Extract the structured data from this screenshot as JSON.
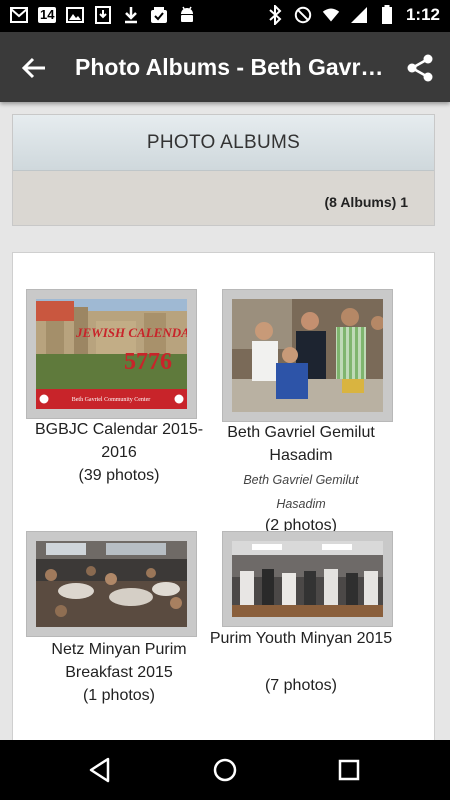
{
  "status_bar": {
    "notification_badge": "14",
    "time": "1:12",
    "left_icons": [
      "gmail-icon",
      "badge-icon",
      "image-icon",
      "download-box-icon",
      "download-icon",
      "checklist-icon",
      "android-icon"
    ],
    "right_icons": [
      "bluetooth-icon",
      "do-not-disturb-icon",
      "wifi-icon",
      "signal-icon",
      "battery-icon"
    ]
  },
  "app_bar": {
    "title": "Photo Albums - Beth Gavriel Bukharian Jewish Congregation",
    "back_icon": "arrow-left-icon",
    "share_icon": "share-icon"
  },
  "header": {
    "title": "PHOTO ALBUMS",
    "count": "(8 Albums) 1"
  },
  "albums": [
    {
      "title": "BGBJC Calendar 2015-2016",
      "subtitle": "",
      "count": "(39 photos)",
      "thumb_text_1": "JEWISH CALENDAR",
      "thumb_text_2": "5776",
      "thumb_text_3": "Beth Gavriel Community Center"
    },
    {
      "title": "Beth Gavriel Gemilut Hasadim",
      "subtitle": "Beth Gavriel Gemilut Hasadim",
      "count": "(2 photos)"
    },
    {
      "title": "Netz Minyan Purim Breakfast 2015",
      "subtitle": "",
      "count": "(1 photos)"
    },
    {
      "title": "Purim Youth Minyan 2015",
      "subtitle": "",
      "count": "(7 photos)"
    }
  ],
  "colors": {
    "app_bar": "#3a3a3a",
    "status_bar": "#000000",
    "calendar_accent": "#c8242a"
  },
  "nav_bar": {
    "icons": [
      "back-triangle-icon",
      "home-circle-icon",
      "recents-square-icon"
    ]
  }
}
